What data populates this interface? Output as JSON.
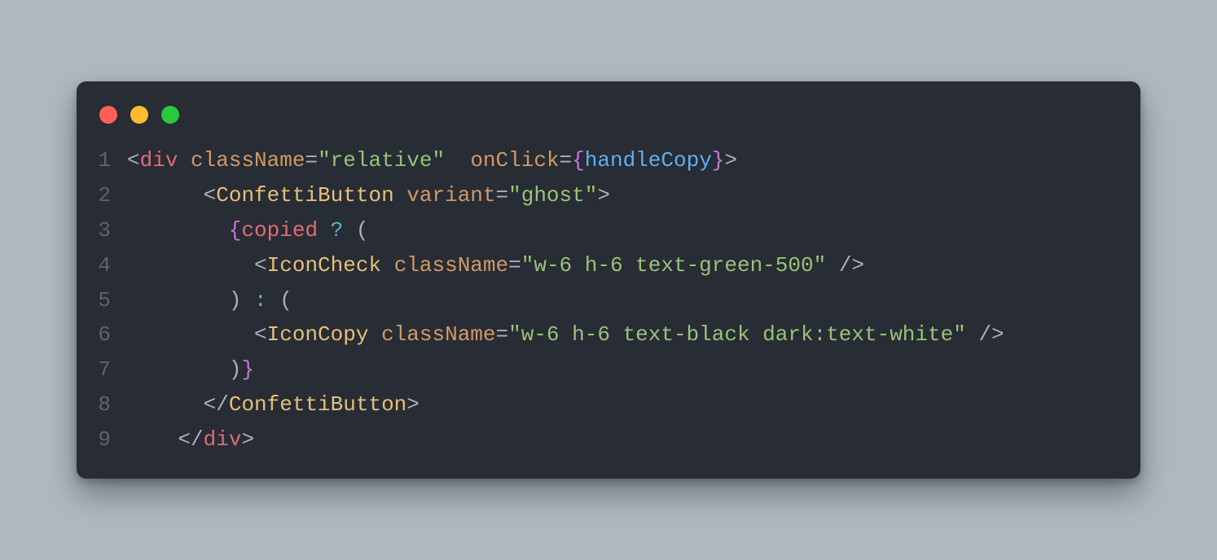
{
  "window": {
    "traffic_lights": [
      "close",
      "minimize",
      "zoom"
    ]
  },
  "code": {
    "lines": [
      {
        "n": "1",
        "tokens": [
          {
            "cls": "p-bracket",
            "t": "<"
          },
          {
            "cls": "p-tag",
            "t": "div"
          },
          {
            "cls": "p-punct",
            "t": " "
          },
          {
            "cls": "p-attr",
            "t": "className"
          },
          {
            "cls": "p-eq",
            "t": "="
          },
          {
            "cls": "p-str",
            "t": "\"relative\""
          },
          {
            "cls": "p-punct",
            "t": "  "
          },
          {
            "cls": "p-attr",
            "t": "onClick"
          },
          {
            "cls": "p-eq",
            "t": "="
          },
          {
            "cls": "p-brace",
            "t": "{"
          },
          {
            "cls": "p-func",
            "t": "handleCopy"
          },
          {
            "cls": "p-brace",
            "t": "}"
          },
          {
            "cls": "p-bracket",
            "t": ">"
          }
        ]
      },
      {
        "n": "2",
        "tokens": [
          {
            "cls": "p-punct",
            "t": "      "
          },
          {
            "cls": "p-bracket",
            "t": "<"
          },
          {
            "cls": "p-comp",
            "t": "ConfettiButton"
          },
          {
            "cls": "p-punct",
            "t": " "
          },
          {
            "cls": "p-attr",
            "t": "variant"
          },
          {
            "cls": "p-eq",
            "t": "="
          },
          {
            "cls": "p-str",
            "t": "\"ghost\""
          },
          {
            "cls": "p-bracket",
            "t": ">"
          }
        ]
      },
      {
        "n": "3",
        "tokens": [
          {
            "cls": "p-punct",
            "t": "        "
          },
          {
            "cls": "p-brace",
            "t": "{"
          },
          {
            "cls": "p-ident",
            "t": "copied"
          },
          {
            "cls": "p-punct",
            "t": " "
          },
          {
            "cls": "p-op",
            "t": "?"
          },
          {
            "cls": "p-punct",
            "t": " "
          },
          {
            "cls": "p-paren",
            "t": "("
          }
        ]
      },
      {
        "n": "4",
        "tokens": [
          {
            "cls": "p-punct",
            "t": "          "
          },
          {
            "cls": "p-bracket",
            "t": "<"
          },
          {
            "cls": "p-comp",
            "t": "IconCheck"
          },
          {
            "cls": "p-punct",
            "t": " "
          },
          {
            "cls": "p-attr",
            "t": "className"
          },
          {
            "cls": "p-eq",
            "t": "="
          },
          {
            "cls": "p-str",
            "t": "\"w-6 h-6 text-green-500\""
          },
          {
            "cls": "p-punct",
            "t": " "
          },
          {
            "cls": "p-bracket",
            "t": "/>"
          }
        ]
      },
      {
        "n": "5",
        "tokens": [
          {
            "cls": "p-punct",
            "t": "        "
          },
          {
            "cls": "p-paren",
            "t": ")"
          },
          {
            "cls": "p-punct",
            "t": " "
          },
          {
            "cls": "p-op",
            "t": ":"
          },
          {
            "cls": "p-punct",
            "t": " "
          },
          {
            "cls": "p-paren",
            "t": "("
          }
        ]
      },
      {
        "n": "6",
        "tokens": [
          {
            "cls": "p-punct",
            "t": "          "
          },
          {
            "cls": "p-bracket",
            "t": "<"
          },
          {
            "cls": "p-comp",
            "t": "IconCopy"
          },
          {
            "cls": "p-punct",
            "t": " "
          },
          {
            "cls": "p-attr",
            "t": "className"
          },
          {
            "cls": "p-eq",
            "t": "="
          },
          {
            "cls": "p-str",
            "t": "\"w-6 h-6 text-black dark:text-white\""
          },
          {
            "cls": "p-punct",
            "t": " "
          },
          {
            "cls": "p-bracket",
            "t": "/>"
          }
        ]
      },
      {
        "n": "7",
        "tokens": [
          {
            "cls": "p-punct",
            "t": "        "
          },
          {
            "cls": "p-paren",
            "t": ")"
          },
          {
            "cls": "p-brace",
            "t": "}"
          }
        ]
      },
      {
        "n": "8",
        "tokens": [
          {
            "cls": "p-punct",
            "t": "      "
          },
          {
            "cls": "p-bracket",
            "t": "</"
          },
          {
            "cls": "p-comp",
            "t": "ConfettiButton"
          },
          {
            "cls": "p-bracket",
            "t": ">"
          }
        ]
      },
      {
        "n": "9",
        "tokens": [
          {
            "cls": "p-punct",
            "t": "    "
          },
          {
            "cls": "p-bracket",
            "t": "</"
          },
          {
            "cls": "p-tag",
            "t": "div"
          },
          {
            "cls": "p-bracket",
            "t": ">"
          }
        ]
      }
    ]
  }
}
